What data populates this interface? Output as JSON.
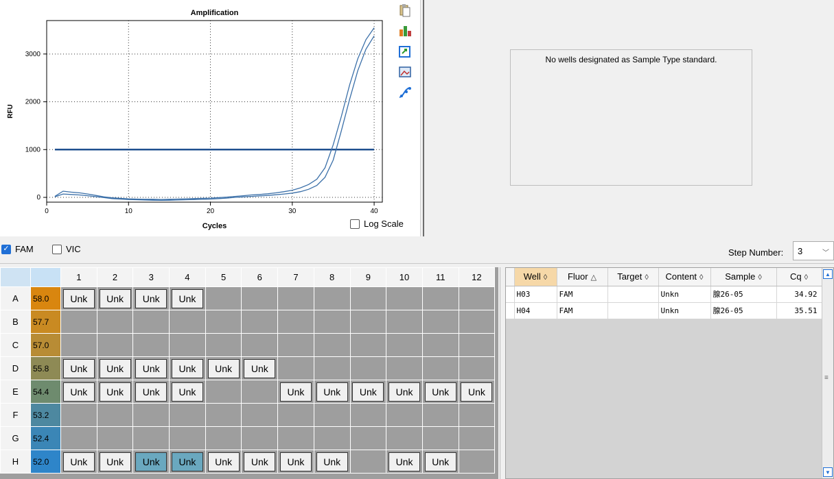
{
  "chart": {
    "toolbar_icons": [
      "copy-icon",
      "chart-settings-icon",
      "export-icon",
      "image-icon",
      "curve-icon"
    ],
    "log_scale_label": "Log Scale",
    "log_scale_checked": false
  },
  "chart_data": {
    "type": "line",
    "title": "Amplification",
    "xlabel": "Cycles",
    "ylabel": "RFU",
    "xlim": [
      0,
      41
    ],
    "ylim": [
      -100,
      3700
    ],
    "x_ticks": [
      0,
      10,
      20,
      30,
      40
    ],
    "y_ticks": [
      0,
      1000,
      2000,
      3000
    ],
    "grid": "dotted",
    "threshold": 1000,
    "line_color": "#3a6fa8",
    "threshold_color": "#1f4f8f",
    "series": [
      {
        "x": [
          1,
          2,
          3,
          4,
          5,
          6,
          7,
          8,
          9,
          10,
          11,
          12,
          13,
          14,
          15,
          16,
          17,
          18,
          19,
          20,
          21,
          22,
          23,
          24,
          25,
          26,
          27,
          28,
          29,
          30,
          31,
          32,
          33,
          34,
          35,
          36,
          37,
          38,
          39,
          40
        ],
        "y": [
          20,
          130,
          110,
          95,
          70,
          40,
          10,
          -10,
          -20,
          -30,
          -35,
          -40,
          -40,
          -45,
          -40,
          -35,
          -30,
          -25,
          -20,
          -15,
          -5,
          5,
          20,
          35,
          50,
          60,
          75,
          95,
          120,
          150,
          200,
          270,
          380,
          620,
          1100,
          1700,
          2350,
          2900,
          3300,
          3550
        ]
      },
      {
        "x": [
          1,
          2,
          3,
          4,
          5,
          6,
          7,
          8,
          9,
          10,
          11,
          12,
          13,
          14,
          15,
          16,
          17,
          18,
          19,
          20,
          21,
          22,
          23,
          24,
          25,
          26,
          27,
          28,
          29,
          30,
          31,
          32,
          33,
          34,
          35,
          36,
          37,
          38,
          39,
          40
        ],
        "y": [
          10,
          70,
          60,
          50,
          35,
          15,
          -5,
          -25,
          -35,
          -45,
          -50,
          -55,
          -60,
          -62,
          -60,
          -55,
          -50,
          -45,
          -40,
          -35,
          -25,
          -15,
          0,
          10,
          20,
          30,
          40,
          55,
          70,
          90,
          120,
          170,
          250,
          420,
          780,
          1400,
          2050,
          2650,
          3100,
          3380
        ]
      }
    ]
  },
  "standard_curve": {
    "message": "No wells designated as Sample Type standard."
  },
  "fluors": [
    {
      "label": "FAM",
      "checked": true
    },
    {
      "label": "VIC",
      "checked": false
    }
  ],
  "step": {
    "label": "Step Number:",
    "value": "3"
  },
  "plate": {
    "columns": [
      "1",
      "2",
      "3",
      "4",
      "5",
      "6",
      "7",
      "8",
      "9",
      "10",
      "11",
      "12"
    ],
    "rows": [
      {
        "label": "A",
        "temp": "58.0",
        "temp_color": "#d9860f",
        "wells": [
          "Unk",
          "Unk",
          "Unk",
          "Unk",
          "",
          "",
          "",
          "",
          "",
          "",
          "",
          ""
        ]
      },
      {
        "label": "B",
        "temp": "57.7",
        "temp_color": "#c98a22",
        "wells": [
          "",
          "",
          "",
          "",
          "",
          "",
          "",
          "",
          "",
          "",
          "",
          ""
        ]
      },
      {
        "label": "C",
        "temp": "57.0",
        "temp_color": "#b88c35",
        "wells": [
          "",
          "",
          "",
          "",
          "",
          "",
          "",
          "",
          "",
          "",
          "",
          ""
        ]
      },
      {
        "label": "D",
        "temp": "55.8",
        "temp_color": "#8e8a55",
        "wells": [
          "Unk",
          "Unk",
          "Unk",
          "Unk",
          "Unk",
          "Unk",
          "",
          "",
          "",
          "",
          "",
          ""
        ]
      },
      {
        "label": "E",
        "temp": "54.4",
        "temp_color": "#6e8b6e",
        "wells": [
          "Unk",
          "Unk",
          "Unk",
          "Unk",
          "",
          "",
          "Unk",
          "Unk",
          "Unk",
          "Unk",
          "Unk",
          "Unk"
        ]
      },
      {
        "label": "F",
        "temp": "53.2",
        "temp_color": "#4d88a0",
        "wells": [
          "",
          "",
          "",
          "",
          "",
          "",
          "",
          "",
          "",
          "",
          "",
          ""
        ]
      },
      {
        "label": "G",
        "temp": "52.4",
        "temp_color": "#3b86b6",
        "wells": [
          "",
          "",
          "",
          "",
          "",
          "",
          "",
          "",
          "",
          "",
          "",
          ""
        ]
      },
      {
        "label": "H",
        "temp": "52.0",
        "temp_color": "#2e85c9",
        "wells": [
          "Unk",
          "Unk",
          "Unk",
          "Unk",
          "Unk",
          "Unk",
          "Unk",
          "Unk",
          "",
          "Unk",
          "Unk",
          ""
        ]
      }
    ],
    "selected_wells": [
      "H3",
      "H4"
    ]
  },
  "results": {
    "columns": [
      {
        "label": "Well",
        "sort": "◊"
      },
      {
        "label": "Fluor",
        "sort": "△"
      },
      {
        "label": "Target",
        "sort": "◊"
      },
      {
        "label": "Content",
        "sort": "◊"
      },
      {
        "label": "Sample",
        "sort": "◊"
      },
      {
        "label": "Cq",
        "sort": "◊"
      }
    ],
    "rows": [
      [
        "H03",
        "FAM",
        "",
        "Unkn",
        "腺26-05",
        "34.92"
      ],
      [
        "H04",
        "FAM",
        "",
        "Unkn",
        "腺26-05",
        "35.51"
      ]
    ]
  }
}
